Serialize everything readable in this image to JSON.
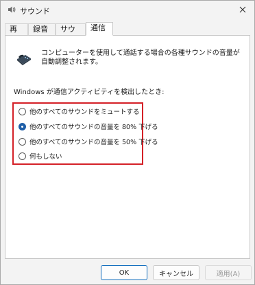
{
  "window": {
    "title": "サウンド"
  },
  "tabs": [
    {
      "label": "再生"
    },
    {
      "label": "録音"
    },
    {
      "label": "サウンド"
    },
    {
      "label": "通信",
      "active": true
    }
  ],
  "panel": {
    "description": "コンピューターを使用して通話する場合の各種サウンドの音量が自動調整されます。",
    "group_label": "Windows が通信アクティビティを検出したとき:",
    "options": [
      {
        "label": "他のすべてのサウンドをミュートする",
        "checked": false
      },
      {
        "label": "他のすべてのサウンドの音量を 80% 下げる",
        "checked": true
      },
      {
        "label": "他のすべてのサウンドの音量を 50% 下げる",
        "checked": false
      },
      {
        "label": "何もしない",
        "checked": false
      }
    ]
  },
  "buttons": {
    "ok": "OK",
    "cancel": "キャンセル",
    "apply": "適用(A)"
  },
  "colors": {
    "highlight_border": "#d42027",
    "accent": "#1f5fa8"
  }
}
